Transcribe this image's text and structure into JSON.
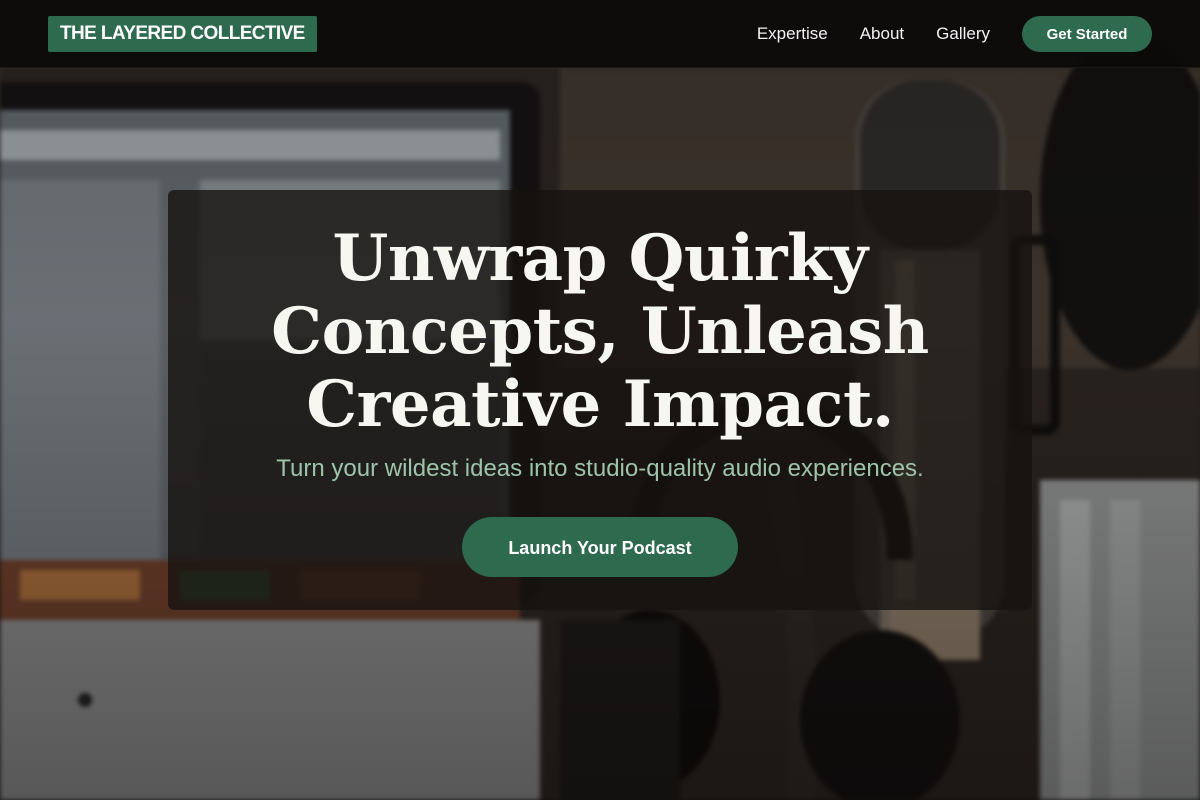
{
  "header": {
    "logo_text": "THE LAYERED COLLECTIVE",
    "nav": [
      {
        "label": "Expertise"
      },
      {
        "label": "About"
      },
      {
        "label": "Gallery"
      }
    ],
    "cta_label": "Get Started"
  },
  "hero": {
    "title_lines": [
      "Unwrap Quirky",
      "Concepts, Unleash",
      "Creative Impact."
    ],
    "subtitle": "Turn your wildest ideas into studio-quality audio experiences.",
    "cta_label": "Launch Your Podcast",
    "background_image": "podcast-studio-microphone-headphones-photo"
  },
  "colors": {
    "accent": "#2e6b4e",
    "subtitle": "#9dc4a8",
    "title": "#f5f7f0",
    "header_bg": "#0c0a0a"
  }
}
